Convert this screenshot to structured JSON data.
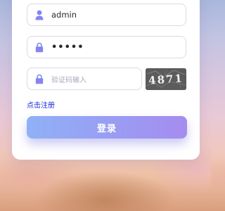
{
  "login_form": {
    "username": {
      "value": "admin",
      "icon": "user-icon"
    },
    "password": {
      "value": "•••••",
      "icon": "lock-icon"
    },
    "captcha": {
      "placeholder": "验证码输入",
      "icon": "lock-icon",
      "image_text": "4871"
    },
    "register_link": "点击注册",
    "login_button": "登录"
  },
  "colors": {
    "icon_accent": "#7b7ff0",
    "link": "#1c2bd6",
    "button_start": "#8fb1f7",
    "button_end": "#a58cf0"
  }
}
